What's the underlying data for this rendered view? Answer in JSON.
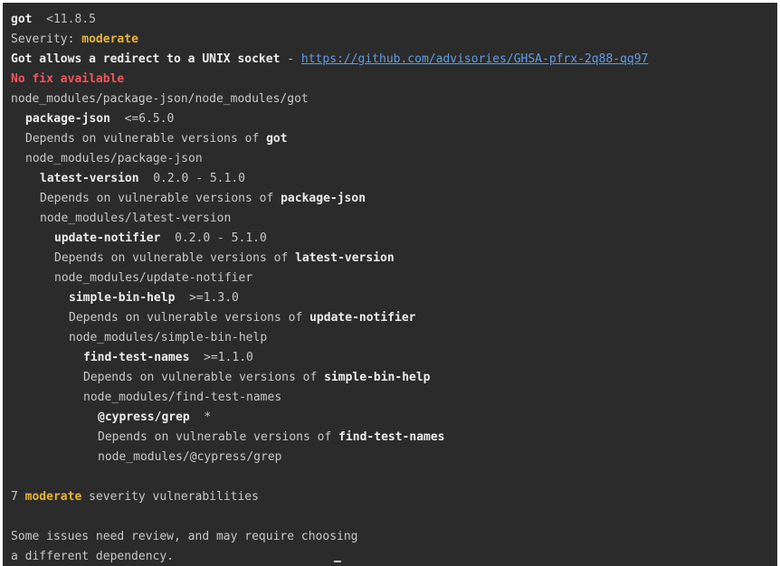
{
  "advisory": {
    "package": "got",
    "range": "<11.8.5",
    "severity_label": "Severity:",
    "severity": "moderate",
    "title": "Got allows a redirect to a UNIX socket",
    "separator": "-",
    "url": "https://github.com/advisories/GHSA-pfrx-2q88-qq97",
    "fix": "No fix available",
    "path": "node_modules/package-json/node_modules/got"
  },
  "depends_prefix": "Depends on vulnerable versions of",
  "chain": [
    {
      "name": "package-json",
      "range": "<=6.5.0",
      "depends_on": "got",
      "path": "node_modules/package-json"
    },
    {
      "name": "latest-version",
      "range": "0.2.0 - 5.1.0",
      "depends_on": "package-json",
      "path": "node_modules/latest-version"
    },
    {
      "name": "update-notifier",
      "range": "0.2.0 - 5.1.0",
      "depends_on": "latest-version",
      "path": "node_modules/update-notifier"
    },
    {
      "name": "simple-bin-help",
      "range": ">=1.3.0",
      "depends_on": "update-notifier",
      "path": "node_modules/simple-bin-help"
    },
    {
      "name": "find-test-names",
      "range": ">=1.1.0",
      "depends_on": "simple-bin-help",
      "path": "node_modules/find-test-names"
    },
    {
      "name": "@cypress/grep",
      "range": "*",
      "depends_on": "find-test-names",
      "path": "node_modules/@cypress/grep"
    }
  ],
  "summary": {
    "count": "7",
    "severity": "moderate",
    "suffix": "severity vulnerabilities"
  },
  "review": {
    "line1": "Some issues need review, and may require choosing",
    "line2": "a different dependency."
  }
}
